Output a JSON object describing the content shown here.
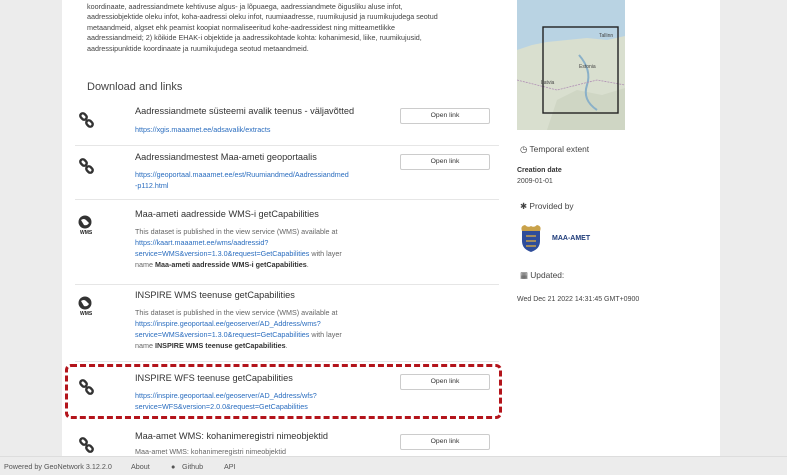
{
  "description": {
    "lines": [
      "koordinaate, aadressiandmete kehtivuse algus- ja lõpuaega, aadressiandmete õigusliku aluse infot,",
      "aadressiobjektide oleku infot, koha-aadressi oleku infot, ruumiaadresse, ruumikujusid ja ruumikujudega seotud",
      "metaandmeid, algset ehk peamist koopiat normaliseeritud kohe-aadressidest ning mitteametlikke",
      "aadressiandmeid; 2) kõikide EHAK-i objektide ja aadressikohtade kohta: kohanimesid, liike, ruumikujusid,",
      "aadressipunktide koordinaate ja ruumikujudega seotud metaandmeid."
    ]
  },
  "section_title": "Download and links",
  "open_label": "Open link",
  "links": [
    {
      "title": "Aadressiandmete süsteemi avalik teenus - väljavõtted",
      "url": "https://xgis.maaamet.ee/adsavalik/extracts"
    },
    {
      "title": "Aadressiandmestest Maa-ameti geoportaalis",
      "url_line1": "https://geoportaal.maaamet.ee/est/Ruumiandmed/Aadressiandmed",
      "url_line2": "-p112.html"
    },
    {
      "title": "Maa-ameti aadresside WMS-i getCapabilities",
      "icon_label": "WMS",
      "text_before": "This dataset is published in the view service (WMS) available at",
      "url_line1": "https://kaart.maaamet.ee/wms/aadressid?",
      "url_line2": "service=WMS&version=1.3.0&request=GetCapabilities",
      "text_after": " with layer",
      "layer_prefix": "name ",
      "layer_name": "Maa-ameti aadresside WMS-i getCapabilities",
      "layer_suffix": "."
    },
    {
      "title": "INSPIRE WMS teenuse getCapabilities",
      "icon_label": "WMS",
      "text_before": "This dataset is published in the view service (WMS) available at",
      "url_line1": "https://inspire.geoportaal.ee/geoserver/AD_Address/wms?",
      "url_line2": "service=WMS&version=1.3.0&request=GetCapabilities",
      "text_after": " with layer",
      "layer_prefix": "name ",
      "layer_name": "INSPIRE WMS teenuse getCapabilities",
      "layer_suffix": "."
    },
    {
      "title": "INSPIRE WFS teenuse getCapabilities",
      "url_line1": "https://inspire.geoportaal.ee/geoserver/AD_Address/wfs?",
      "url_line2": "service=WFS&version=2.0.0&request=GetCapabilities"
    },
    {
      "title": "Maa-amet WMS: kohanimeregistri nimeobjektid",
      "text_before": "Maa-amet WMS: kohanimeregistri nimeobjektid"
    }
  ],
  "sidebar": {
    "map_labels": [
      "Tallinn",
      "Estonia",
      "Latvia"
    ],
    "temporal_extent": "Temporal extent",
    "creation_label": "Creation date",
    "creation_value": "2009-01-01",
    "provided_by": "Provided by",
    "org_name": "MAA-AMET",
    "updated_label": "Updated:",
    "updated_value": "Wed Dec 21 2022 14:31:45 GMT+0900"
  },
  "footer": {
    "powered": "Powered by GeoNetwork 3.12.2.0",
    "about": "About",
    "github": "Github",
    "api": "API"
  },
  "colors": {
    "link": "#2a6dbf",
    "highlight": "#b3141b",
    "map_water": "#b9d3e3",
    "map_land": "#d9dfcf"
  }
}
